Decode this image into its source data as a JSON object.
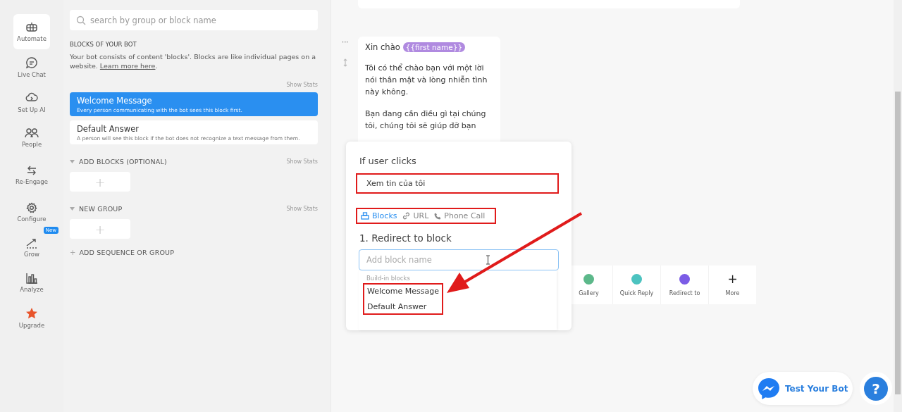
{
  "nav": {
    "items": [
      {
        "label": "Automate",
        "selected": true
      },
      {
        "label": "Live Chat",
        "selected": false
      },
      {
        "label": "Set Up AI",
        "selected": false
      },
      {
        "label": "People",
        "selected": false
      },
      {
        "label": "Re-Engage",
        "selected": false
      },
      {
        "label": "Configure",
        "selected": false
      },
      {
        "label": "Grow",
        "selected": false,
        "badge": "New"
      },
      {
        "label": "Analyze",
        "selected": false
      },
      {
        "label": "Upgrade",
        "selected": false
      }
    ]
  },
  "blocks_panel": {
    "search": {
      "placeholder": "search by group or block name"
    },
    "heading": "BLOCKS OF YOUR BOT",
    "description": "Your bot consists of content 'blocks'. Blocks are like individual pages on a website.",
    "link": "Learn more here",
    "link_suffix": ".",
    "show_stats": "Show Stats",
    "blocks": [
      {
        "title": "Welcome Message",
        "subtitle": "Every person communicating with the bot sees this block first.",
        "selected": true
      },
      {
        "title": "Default Answer",
        "subtitle": "A person will see this block if the bot does not recognize a text message from them.",
        "selected": false
      }
    ],
    "groups": [
      {
        "title": "ADD BLOCKS (OPTIONAL)",
        "show_stats": "Show Stats",
        "add": "+"
      },
      {
        "title": "NEW GROUP",
        "show_stats": "Show Stats",
        "add": "+"
      }
    ],
    "add_sequence": {
      "icon": "+",
      "label": "ADD SEQUENCE OR GROUP"
    }
  },
  "canvas": {
    "message": {
      "greeting": "Xin chào",
      "variable": "{{first name}}",
      "paragraphs": [
        "Tôi có thể chào bạn với một lời nói thân mật và lòng nhiễn tình này không.",
        "Bạn đang cần điều gì tại chúng tôi, chúng tôi sẽ giúp đỡ bạn"
      ]
    },
    "more_icon": "···",
    "popup": {
      "title": "If user clicks",
      "button_title": {
        "value": "Xem tin của tôi",
        "highlighted": true
      },
      "tabs_highlighted": true,
      "tabs": [
        {
          "label": "Blocks",
          "selected": true
        },
        {
          "label": "URL",
          "selected": false
        },
        {
          "label": "Phone Call",
          "selected": false
        }
      ],
      "step": "1. Redirect to block",
      "block_input": {
        "placeholder": "Add block name"
      },
      "dropdown": {
        "section": "Build-in blocks",
        "highlighted": true,
        "options": [
          "Welcome Message",
          "Default Answer"
        ]
      }
    },
    "toolbar": [
      {
        "label": "Gallery",
        "color": "#5cb88a"
      },
      {
        "label": "Quick Reply",
        "color": "#4cc3c0"
      },
      {
        "label": "Redirect to",
        "color": "#7b5ce6"
      },
      {
        "label": "More",
        "icon": "+"
      }
    ],
    "test_button": "Test Your Bot",
    "help_button": "?"
  }
}
